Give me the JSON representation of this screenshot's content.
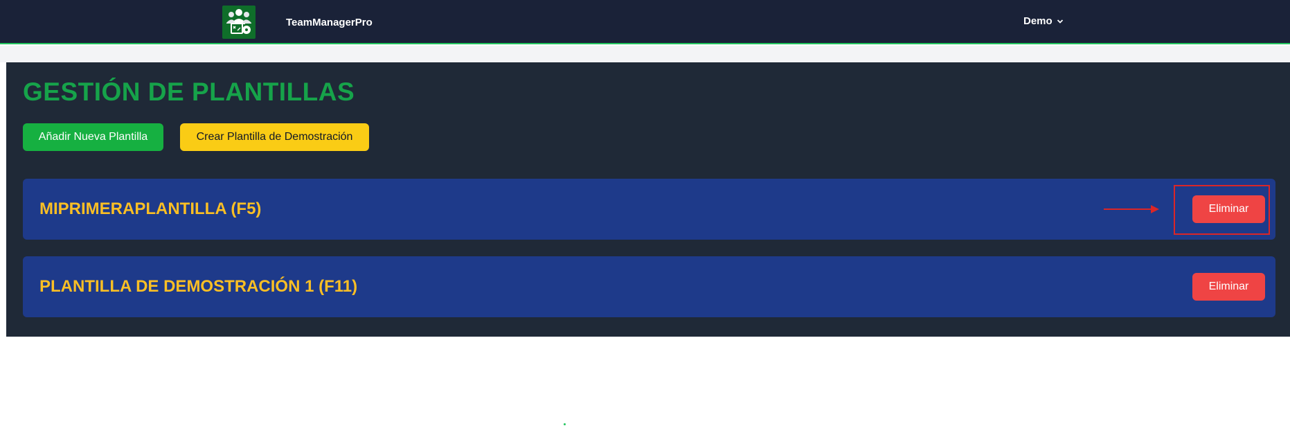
{
  "header": {
    "app_name": "TeamManagerPro",
    "logo_icon": "team-tactics-icon",
    "user_menu_label": "Demo",
    "user_menu_icon": "chevron-down-icon"
  },
  "main": {
    "title": "GESTIÓN DE PLANTILLAS",
    "add_button_label": "Añadir Nueva Plantilla",
    "demo_button_label": "Crear Plantilla de Demostración",
    "templates": [
      {
        "name": "MIPRIMERAPLANTILLA (F5)",
        "delete_label": "Eliminar"
      },
      {
        "name": "PLANTILLA DE DEMOSTRACIÓN 1 (F11)",
        "delete_label": "Eliminar"
      }
    ]
  },
  "colors": {
    "header_bg": "#1a2238",
    "panel_bg": "#1f2937",
    "card_bg": "#1e3a8a",
    "title_green": "#16a34a",
    "add_green": "#16b041",
    "demo_yellow": "#facc15",
    "card_title_yellow": "#fbbf24",
    "delete_red": "#ef4444",
    "annotation_red": "#dc2626"
  }
}
